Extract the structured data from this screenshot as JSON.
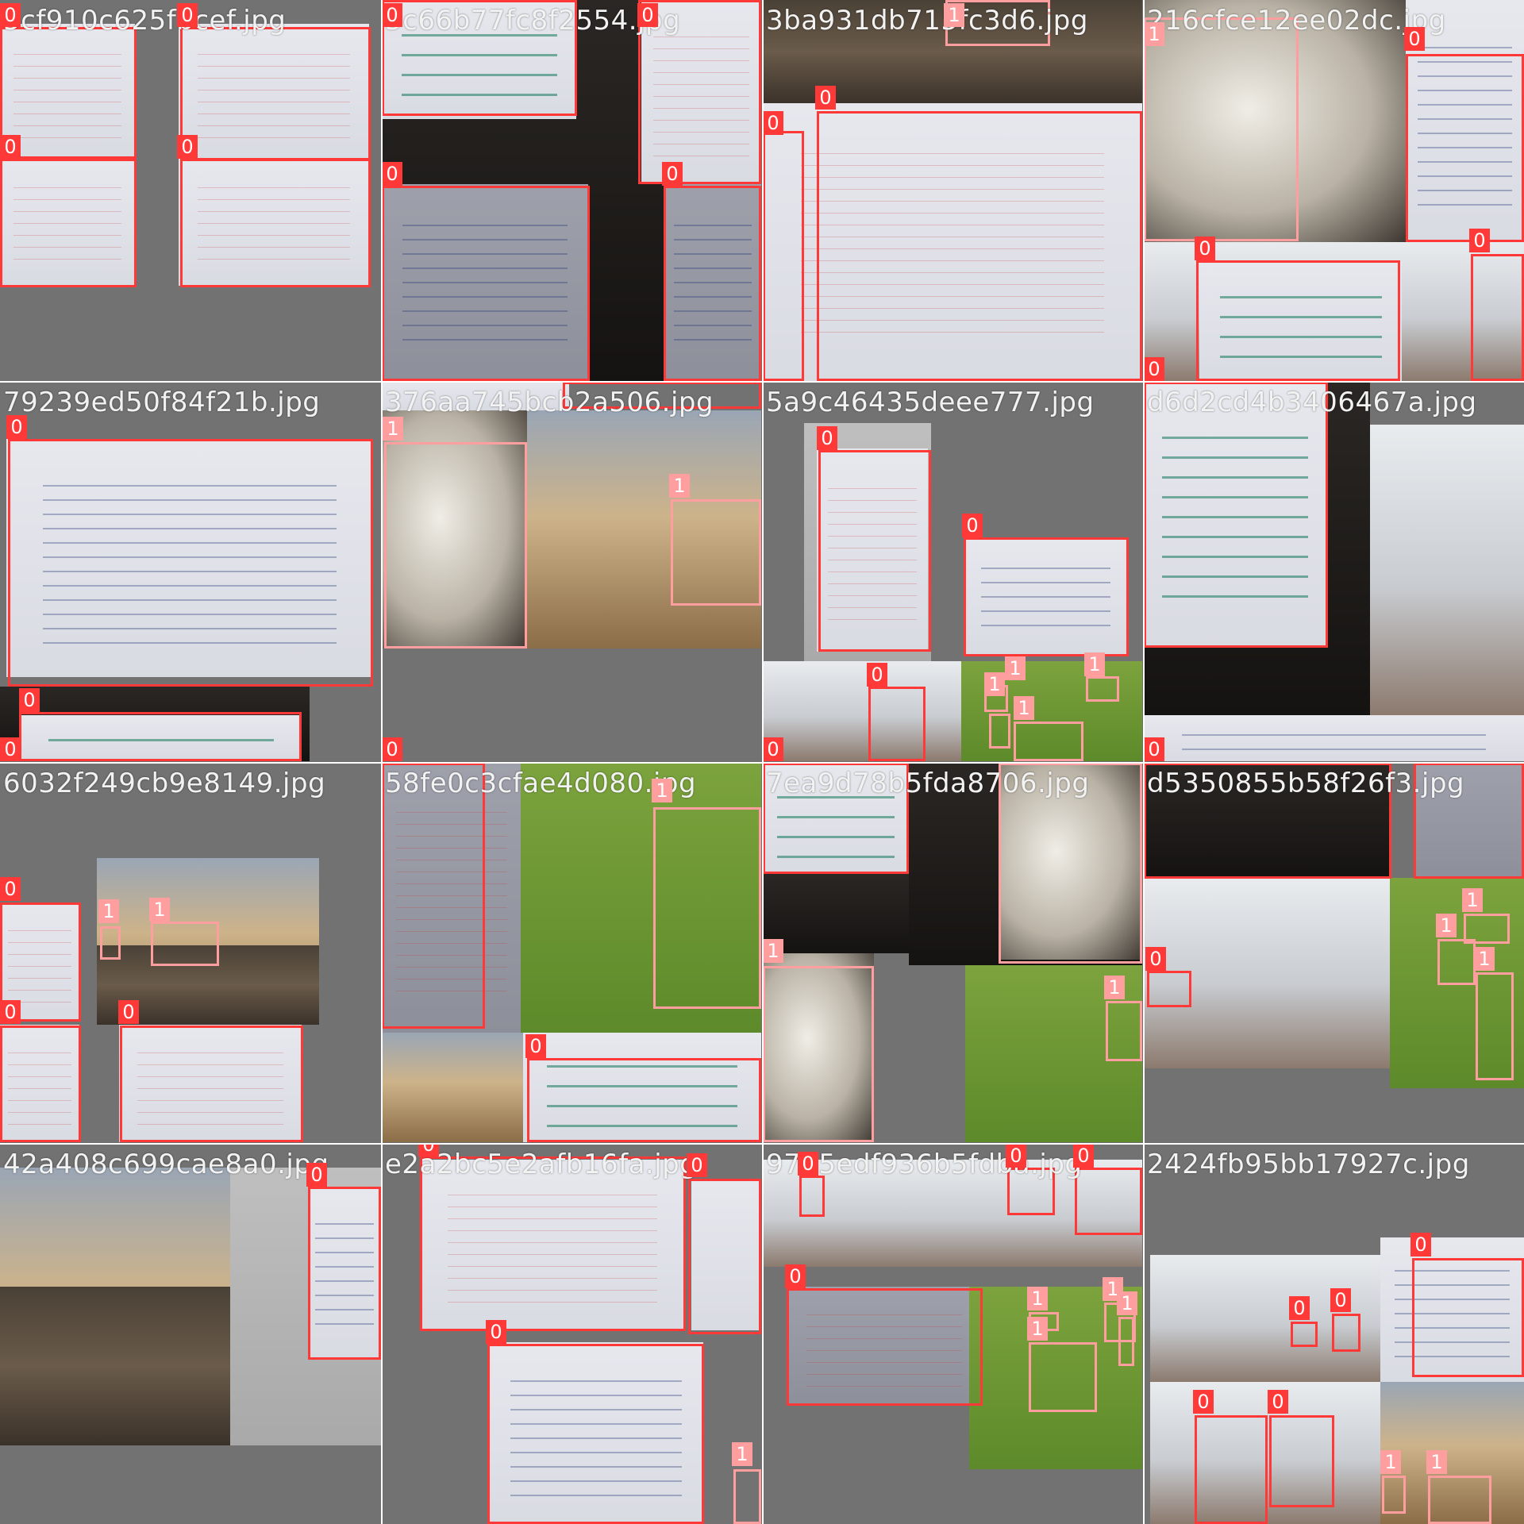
{
  "mosaic": {
    "tiles": [
      {
        "title": "5cf910c625fbcef.jpg"
      },
      {
        "title": "5c66b77fc8f2554.jpg"
      },
      {
        "title": "3ba931db715fc3d6.jpg"
      },
      {
        "title": "216cfce12ee02dc.jpg"
      },
      {
        "title": "79239ed50f84f21b.jpg"
      },
      {
        "title": "376aa745bcb2a506.jpg"
      },
      {
        "title": "5a9c46435deee777.jpg"
      },
      {
        "title": "d6d2cd4b3406467a.jpg"
      },
      {
        "title": "6032f249cb9e8149.jpg"
      },
      {
        "title": "58fe0c3cfae4d080.jpg"
      },
      {
        "title": "7ea9d78b5fda8706.jpg"
      },
      {
        "title": "d5350855b58f26f3.jpg"
      },
      {
        "title": "42a408c699cae8a0.jpg"
      },
      {
        "title": "e2a2bc5e2afb16fa.jpg"
      },
      {
        "title": "9725edf936b5fdba.jpg"
      },
      {
        "title": "2424fb95bb17927c.jpg"
      }
    ],
    "class_labels": {
      "whiteboard": "0",
      "alpaca": "1"
    },
    "colors": {
      "class0": "#ff3838",
      "class1": "#ff9e9e",
      "separator": "#ffffff",
      "pad": "#727272"
    }
  }
}
